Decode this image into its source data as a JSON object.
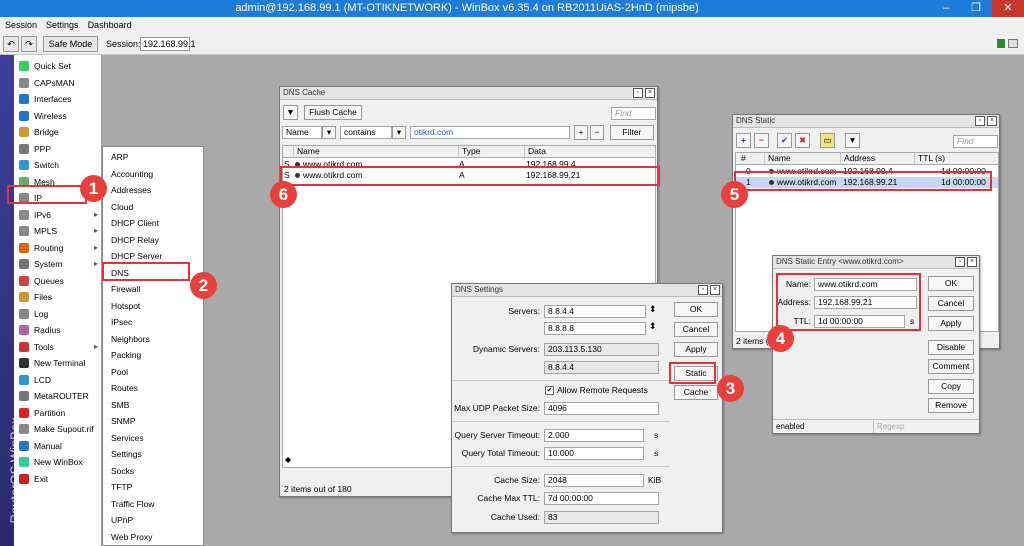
{
  "title": "admin@192.168.99.1 (MT-OTIKNETWORK) - WinBox v6.35.4 on RB2011UiAS-2HnD (mipsbe)",
  "menu": [
    "Session",
    "Settings",
    "Dashboard"
  ],
  "toolbar": {
    "safe_mode": "Safe Mode",
    "session_label": "Session:",
    "session_value": "192.168.99.1"
  },
  "vertical_text": "RouterOS WinBox",
  "sidebar": [
    "Quick Set",
    "CAPsMAN",
    "Interfaces",
    "Wireless",
    "Bridge",
    "PPP",
    "Switch",
    "Mesh",
    "IP",
    "IPv6",
    "MPLS",
    "Routing",
    "System",
    "Queues",
    "Files",
    "Log",
    "Radius",
    "Tools",
    "New Terminal",
    "LCD",
    "MetaROUTER",
    "Partition",
    "Make Supout.rif",
    "Manual",
    "New WinBox",
    "Exit"
  ],
  "submenu": [
    "ARP",
    "Accounting",
    "Addresses",
    "Cloud",
    "DHCP Client",
    "DHCP Relay",
    "DHCP Server",
    "DNS",
    "Firewall",
    "Hotspot",
    "IPsec",
    "Neighbors",
    "Packing",
    "Pool",
    "Routes",
    "SMB",
    "SNMP",
    "Services",
    "Settings",
    "Socks",
    "TFTP",
    "Traffic Flow",
    "UPnP",
    "Web Proxy"
  ],
  "dns_cache": {
    "title": "DNS Cache",
    "flush": "Flush Cache",
    "find": "Find",
    "filter_field": "Name",
    "filter_op": "contains",
    "filter_value": "otikrd.com",
    "filter_btn": "Filter",
    "cols": [
      "Name",
      "Type",
      "Data"
    ],
    "rows": [
      {
        "f": "S",
        "name": "www.otikrd.com",
        "type": "A",
        "data": "192.168.99.4"
      },
      {
        "f": "S",
        "name": "www.otikrd.com",
        "type": "A",
        "data": "192.168.99.21"
      }
    ],
    "status": "2 items out of 180"
  },
  "dns_static": {
    "title": "DNS Static",
    "find": "Find",
    "cols": [
      "#",
      "Name",
      "Address",
      "TTL (s)"
    ],
    "rows": [
      {
        "n": "0",
        "name": "www.otikrd.com",
        "addr": "192.168.99.4",
        "ttl": "1d 00:00:00"
      },
      {
        "n": "1",
        "name": "www.otikrd.com",
        "addr": "192.168.99.21",
        "ttl": "1d 00:00:00"
      }
    ],
    "status": "2 items ("
  },
  "dns_settings": {
    "title": "DNS Settings",
    "servers_label": "Servers:",
    "server1": "8.8.4.4",
    "server2": "8.8.8.8",
    "dyn_label": "Dynamic Servers:",
    "dyn1": "203.113.5.130",
    "dyn2": "8.8.4.4",
    "allow": "Allow Remote Requests",
    "udp_label": "Max UDP Packet Size:",
    "udp": "4096",
    "qst_label": "Query Server Timeout:",
    "qst": "2.000",
    "qtt_label": "Query Total Timeout:",
    "qtt": "10.000",
    "s": "s",
    "cs_label": "Cache Size:",
    "cs": "2048",
    "kib": "KiB",
    "cmt_label": "Cache Max TTL:",
    "cmt": "7d 00:00:00",
    "cu_label": "Cache Used:",
    "cu": "83",
    "btns": [
      "OK",
      "Cancel",
      "Apply",
      "Static",
      "Cache"
    ]
  },
  "static_entry": {
    "title": "DNS Static Entry <www.otikrd.com>",
    "name_label": "Name:",
    "name": "www.otikrd.com",
    "addr_label": "Address:",
    "addr": "192.168.99.21",
    "ttl_label": "TTL:",
    "ttl": "1d 00:00:00",
    "s": "s",
    "btns": [
      "OK",
      "Cancel",
      "Apply",
      "Disable",
      "Comment",
      "Copy",
      "Remove"
    ],
    "status": "enabled",
    "regexp": "Regexp"
  },
  "callouts": [
    "1",
    "2",
    "3",
    "4",
    "5",
    "6"
  ]
}
